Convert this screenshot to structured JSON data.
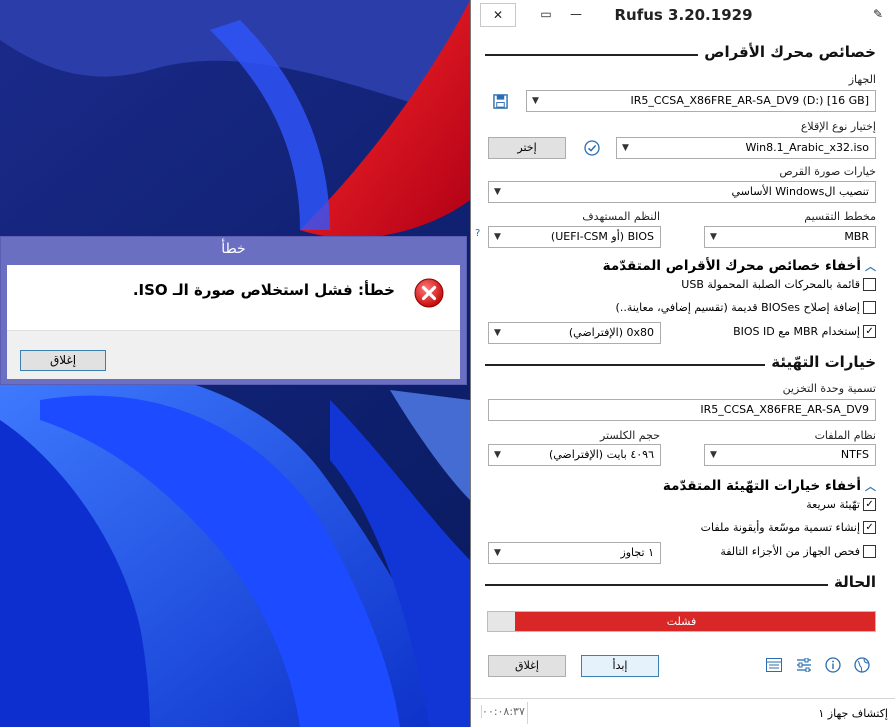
{
  "rufus": {
    "title": "Rufus 3.20.1929",
    "drive_properties_heading": "خصائص محرك الأقراص",
    "device_label": "الجهاز",
    "device_value": "IR5_CCSA_X86FRE_AR-SA_DV9 (D:) [16 GB]",
    "boot_selection_label": "إختيار نوع الإقلاع",
    "boot_selection_value": "Win8.1_Arabic_x32.iso",
    "select_button": "إختر",
    "image_option_label": "خيارات صورة القرص",
    "image_option_value": "تنصيب الWindows الأساسي",
    "partition_scheme_label": "مخطط التقسيم",
    "partition_scheme_value": "MBR",
    "target_system_label": "النظم المستهدف",
    "target_system_value": "BIOS (أو UEFI-CSM)",
    "target_help": "?",
    "advanced_drive_toggle": "أخفاء خصائص محرك الأقراص المتقدّمة",
    "list_usb_hdd": "قائمة بالمحركات الصلبة المحمولة USB",
    "old_bios_fixes": "إضافة إصلاح BIOSes قديمة (تقسيم إضافي، معاينة..)",
    "use_mbr_bios_id": "إستخدام MBR مع BIOS ID",
    "bios_id_value": "0x80 (الإفتراضي)",
    "format_options_heading": "خيارات التهّيئة",
    "volume_label_label": "تسمية وحدة التخزين",
    "volume_label_value": "IR5_CCSA_X86FRE_AR-SA_DV9",
    "file_system_label": "نظام الملفات",
    "file_system_value": "NTFS",
    "cluster_size_label": "حجم الكلستر",
    "cluster_size_value": "٤٠٩٦ بايت (الإفتراضي)",
    "advanced_format_toggle": "أخفاء خيارات التهّيئة المتقدّمة",
    "quick_format": "تهّيئة سريعة",
    "extended_label": "إنشاء تسمية موسّعة وأيقونة ملفات",
    "check_bad_blocks": "فحص الجهاز من الأجزاء التالفة",
    "passes_value": "١ تجاوز",
    "status_heading": "الحالة",
    "progress_text": "فشلت",
    "progress_fraction": 0.93,
    "start_button": "إبدأ",
    "close_button": "إغلاق",
    "status_left": "٠٠:٠٨:٣٧",
    "status_right": "إكتشاف جهاز ١",
    "checks": {
      "list_usb_hdd": false,
      "old_bios_fixes": false,
      "use_mbr_bios_id": true,
      "quick_format": true,
      "extended_label": true,
      "check_bad_blocks": false
    },
    "icons": {
      "save": "floppy-disk-icon",
      "check": "checkmark-circle-icon",
      "log": "log-icon",
      "settings": "settings-sliders-icon",
      "about": "info-icon",
      "language": "globe-icon"
    }
  },
  "dialog": {
    "title": "خطأ",
    "message": "خطأ: فشل استخلاص صورة الـ ISO.",
    "close_button": "إغلاق"
  },
  "colors": {
    "progress_fail": "#d92727",
    "dialog_title": "#6b6fc2",
    "accent": "#2a6db0"
  }
}
